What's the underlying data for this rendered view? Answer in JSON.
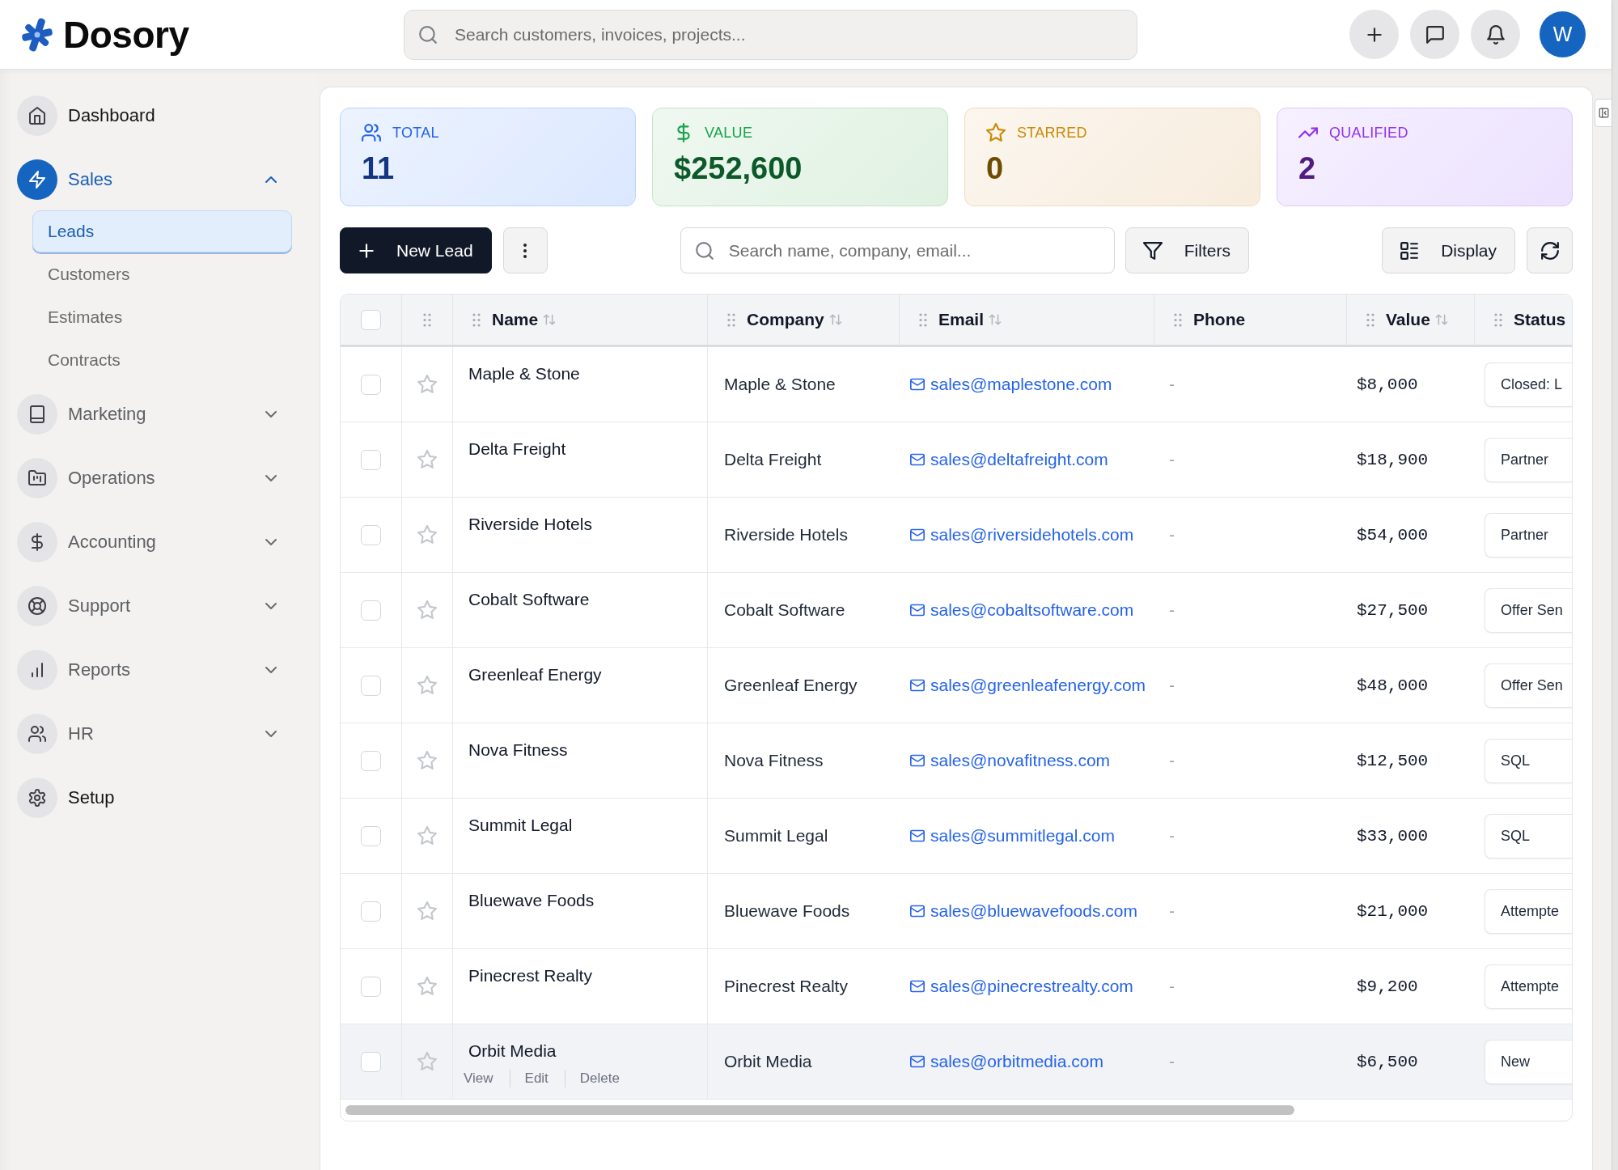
{
  "app": {
    "logo": "Dosory",
    "search": {
      "placeholder": "Search customers, invoices, projects..."
    },
    "avatar": "W"
  },
  "sidebar": {
    "items": [
      {
        "label": "Dashboard",
        "kind": "link",
        "selected": false
      },
      {
        "label": "Sales",
        "kind": "group",
        "selected": true,
        "expanded": true,
        "children": [
          {
            "label": "Leads",
            "selected": true
          },
          {
            "label": "Customers",
            "selected": false
          },
          {
            "label": "Estimates",
            "selected": false
          },
          {
            "label": "Contracts",
            "selected": false
          }
        ]
      },
      {
        "label": "Marketing",
        "kind": "group",
        "selected": false,
        "expanded": false
      },
      {
        "label": "Operations",
        "kind": "group",
        "selected": false,
        "expanded": false
      },
      {
        "label": "Accounting",
        "kind": "group",
        "selected": false,
        "expanded": false
      },
      {
        "label": "Support",
        "kind": "group",
        "selected": false,
        "expanded": false
      },
      {
        "label": "Reports",
        "kind": "group",
        "selected": false,
        "expanded": false
      },
      {
        "label": "HR",
        "kind": "group",
        "selected": false,
        "expanded": false
      },
      {
        "label": "Setup",
        "kind": "link",
        "selected": false
      }
    ]
  },
  "stats": [
    {
      "label": "TOTAL",
      "value": "11",
      "color": "#2563eb"
    },
    {
      "label": "VALUE",
      "value": "$252,600",
      "color": "#16a34a"
    },
    {
      "label": "STARRED",
      "value": "0",
      "color": "#ca8a04"
    },
    {
      "label": "QUALIFIED",
      "value": "2",
      "color": "#9333ea"
    }
  ],
  "toolbar": {
    "new_button": "New Lead",
    "search": {
      "placeholder": "Search name, company, email..."
    },
    "filters_button": "Filters",
    "display_button": "Display"
  },
  "table": {
    "select_all": {
      "checked": false
    },
    "columns": [
      {
        "label": "Name",
        "sortable": true
      },
      {
        "label": "Company",
        "sortable": true
      },
      {
        "label": "Email",
        "sortable": true
      },
      {
        "label": "Phone",
        "sortable": false
      },
      {
        "label": "Value",
        "sortable": true
      },
      {
        "label": "Status",
        "sortable": false
      }
    ],
    "rows": [
      {
        "checked": false,
        "starred": false,
        "highlighted": false,
        "name": "Maple & Stone",
        "company": "Maple & Stone",
        "email": "sales@maplestone.com",
        "phone": "-",
        "value": "$8,000",
        "status": "Closed: L"
      },
      {
        "checked": false,
        "starred": false,
        "highlighted": false,
        "name": "Delta Freight",
        "company": "Delta Freight",
        "email": "sales@deltafreight.com",
        "phone": "-",
        "value": "$18,900",
        "status": "Partner"
      },
      {
        "checked": false,
        "starred": false,
        "highlighted": false,
        "name": "Riverside Hotels",
        "company": "Riverside Hotels",
        "email": "sales@riversidehotels.com",
        "phone": "-",
        "value": "$54,000",
        "status": "Partner"
      },
      {
        "checked": false,
        "starred": false,
        "highlighted": false,
        "name": "Cobalt Software",
        "company": "Cobalt Software",
        "email": "sales@cobaltsoftware.com",
        "phone": "-",
        "value": "$27,500",
        "status": "Offer Sen"
      },
      {
        "checked": false,
        "starred": false,
        "highlighted": false,
        "name": "Greenleaf Energy",
        "company": "Greenleaf Energy",
        "email": "sales@greenleafenergy.com",
        "phone": "-",
        "value": "$48,000",
        "status": "Offer Sen"
      },
      {
        "checked": false,
        "starred": false,
        "highlighted": false,
        "name": "Nova Fitness",
        "company": "Nova Fitness",
        "email": "sales@novafitness.com",
        "phone": "-",
        "value": "$12,500",
        "status": "SQL"
      },
      {
        "checked": false,
        "starred": false,
        "highlighted": false,
        "name": "Summit Legal",
        "company": "Summit Legal",
        "email": "sales@summitlegal.com",
        "phone": "-",
        "value": "$33,000",
        "status": "SQL"
      },
      {
        "checked": false,
        "starred": false,
        "highlighted": false,
        "name": "Bluewave Foods",
        "company": "Bluewave Foods",
        "email": "sales@bluewavefoods.com",
        "phone": "-",
        "value": "$21,000",
        "status": "Attempte"
      },
      {
        "checked": false,
        "starred": false,
        "highlighted": false,
        "name": "Pinecrest Realty",
        "company": "Pinecrest Realty",
        "email": "sales@pinecrestrealty.com",
        "phone": "-",
        "value": "$9,200",
        "status": "Attempte"
      },
      {
        "checked": false,
        "starred": false,
        "highlighted": true,
        "name": "Orbit Media",
        "company": "Orbit Media",
        "email": "sales@orbitmedia.com",
        "phone": "-",
        "value": "$6,500",
        "status": "New",
        "actions": [
          "View",
          "Edit",
          "Delete"
        ]
      }
    ]
  }
}
